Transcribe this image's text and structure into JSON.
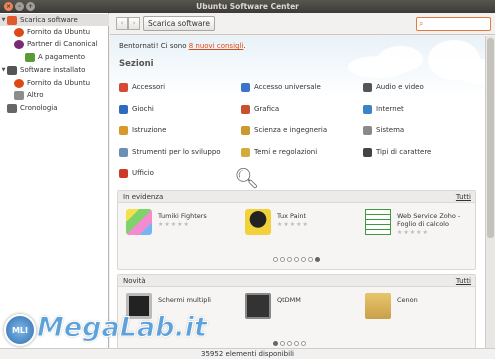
{
  "window": {
    "title": "Ubuntu Software Center"
  },
  "sidebar": {
    "items": [
      {
        "label": "Scarica software",
        "icon": "download-icon",
        "color": "#e05a2b",
        "arrow": "▼",
        "level": 0,
        "selected": true
      },
      {
        "label": "Fornito da Ubuntu",
        "icon": "ubuntu-icon",
        "color": "#dd4814",
        "level": 1
      },
      {
        "label": "Partner di Canonical",
        "icon": "canonical-icon",
        "color": "#7a2a6e",
        "level": 1
      },
      {
        "label": "A pagamento",
        "icon": "paid-icon",
        "color": "#5b9b37",
        "level": 2
      },
      {
        "label": "Software installato",
        "icon": "computer-icon",
        "color": "#555555",
        "arrow": "▼",
        "level": 0
      },
      {
        "label": "Fornito da Ubuntu",
        "icon": "ubuntu-icon",
        "color": "#dd4814",
        "level": 1
      },
      {
        "label": "Altro",
        "icon": "package-icon",
        "color": "#8d8d8d",
        "level": 1
      },
      {
        "label": "Cronologia",
        "icon": "history-icon",
        "color": "#666666",
        "level": 0
      }
    ]
  },
  "toolbar": {
    "back": "‹",
    "forward": "›",
    "breadcrumb": "Scarica software",
    "search_value": "",
    "search_placeholder": ""
  },
  "banner": {
    "prefix": "Bentornati! Ci sono ",
    "link": "8 nuovi consigli",
    "suffix": "."
  },
  "sections_title": "Sezioni",
  "categories": [
    {
      "label": "Accessori",
      "icon": "accessories-icon",
      "color": "#d64937"
    },
    {
      "label": "Accesso universale",
      "icon": "universal-access-icon",
      "color": "#3b74c8"
    },
    {
      "label": "Audio e video",
      "icon": "audio-video-icon",
      "color": "#555555"
    },
    {
      "label": "Giochi",
      "icon": "games-icon",
      "color": "#2e6cbf"
    },
    {
      "label": "Grafica",
      "icon": "graphics-icon",
      "color": "#c8502e"
    },
    {
      "label": "Internet",
      "icon": "internet-icon",
      "color": "#3c82c6"
    },
    {
      "label": "Istruzione",
      "icon": "education-icon",
      "color": "#d69a2a"
    },
    {
      "label": "Scienza e ingegneria",
      "icon": "science-icon",
      "color": "#c89a30"
    },
    {
      "label": "Sistema",
      "icon": "system-icon",
      "color": "#8a8a8a"
    },
    {
      "label": "Strumenti per lo sviluppo",
      "icon": "developer-tools-icon",
      "color": "#6b8fb5"
    },
    {
      "label": "Temi e regolazioni",
      "icon": "themes-icon",
      "color": "#d4aa3a"
    },
    {
      "label": "Tipi di carattere",
      "icon": "fonts-icon",
      "color": "#444444"
    },
    {
      "label": "Ufficio",
      "icon": "office-icon",
      "color": "#cc3a2a"
    }
  ],
  "featured": {
    "title": "In evidenza",
    "all_label": "Tutti",
    "apps": [
      {
        "name": "Tumiki Fighters",
        "icon": "tumiki-fighters-icon",
        "stars": "★★★★★"
      },
      {
        "name": "Tux Paint",
        "icon": "tux-paint-icon",
        "stars": "★★★★★"
      },
      {
        "name": "Web Service Zoho - Foglio di calcolo",
        "icon": "zoho-sheet-icon",
        "stars": "★★★★★"
      }
    ],
    "page_count": 7,
    "active_page": 7
  },
  "new": {
    "title": "Novità",
    "all_label": "Tutti",
    "apps": [
      {
        "name": "Schermi multipli",
        "icon": "monitor-icon",
        "stars": ""
      },
      {
        "name": "QtDMM",
        "icon": "qtdmm-icon",
        "stars": ""
      },
      {
        "name": "Cenon",
        "icon": "cenon-icon",
        "stars": ""
      }
    ],
    "page_count": 5,
    "active_page": 1
  },
  "status": "35952 elementi disponibili",
  "watermark": {
    "badge": "MLI",
    "text": "MegaLab.it"
  }
}
